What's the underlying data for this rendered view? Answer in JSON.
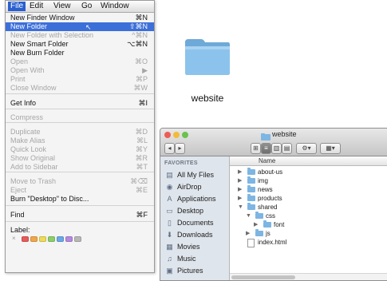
{
  "menubar": {
    "file": "File",
    "edit": "Edit",
    "view": "View",
    "go": "Go",
    "window": "Window"
  },
  "menu_items": [
    {
      "label": "New Finder Window",
      "shortcut": "⌘N",
      "state": "enabled"
    },
    {
      "label": "New Folder",
      "shortcut": "⇧⌘N",
      "state": "highlighted"
    },
    {
      "label": "New Folder with Selection",
      "shortcut": "^⌘N",
      "state": "disabled"
    },
    {
      "label": "New Smart Folder",
      "shortcut": "⌥⌘N",
      "state": "enabled"
    },
    {
      "label": "New Burn Folder",
      "shortcut": "",
      "state": "enabled"
    },
    {
      "label": "Open",
      "shortcut": "⌘O",
      "state": "disabled"
    },
    {
      "label": "Open With",
      "shortcut": "▶",
      "state": "disabled"
    },
    {
      "label": "Print",
      "shortcut": "⌘P",
      "state": "disabled"
    },
    {
      "label": "Close Window",
      "shortcut": "⌘W",
      "state": "disabled"
    },
    {
      "label": "Get Info",
      "shortcut": "⌘I",
      "state": "enabled"
    },
    {
      "label": "Compress",
      "shortcut": "",
      "state": "disabled"
    },
    {
      "label": "Duplicate",
      "shortcut": "⌘D",
      "state": "disabled"
    },
    {
      "label": "Make Alias",
      "shortcut": "⌘L",
      "state": "disabled"
    },
    {
      "label": "Quick Look",
      "shortcut": "⌘Y",
      "state": "disabled"
    },
    {
      "label": "Show Original",
      "shortcut": "⌘R",
      "state": "disabled"
    },
    {
      "label": "Add to Sidebar",
      "shortcut": "⌘T",
      "state": "disabled"
    },
    {
      "label": "Move to Trash",
      "shortcut": "⌘⌫",
      "state": "disabled"
    },
    {
      "label": "Eject",
      "shortcut": "⌘E",
      "state": "disabled"
    },
    {
      "label": "Burn \"Desktop\" to Disc...",
      "shortcut": "",
      "state": "enabled"
    },
    {
      "label": "Find",
      "shortcut": "⌘F",
      "state": "enabled"
    },
    {
      "label": "Label:",
      "shortcut": "",
      "state": "enabled"
    }
  ],
  "label_colors": [
    "#e85a5a",
    "#f0a74a",
    "#eedb58",
    "#8ccf6a",
    "#6aa8e8",
    "#b58ae0",
    "#b8b8b8"
  ],
  "folder": {
    "name": "website",
    "color": "#86bde8"
  },
  "finder": {
    "title": "website",
    "sidebar_heading": "FAVORITES",
    "sidebar_items": [
      {
        "label": "All My Files",
        "icon": "all-files-icon"
      },
      {
        "label": "AirDrop",
        "icon": "airdrop-icon"
      },
      {
        "label": "Applications",
        "icon": "applications-icon"
      },
      {
        "label": "Desktop",
        "icon": "desktop-icon"
      },
      {
        "label": "Documents",
        "icon": "documents-icon"
      },
      {
        "label": "Downloads",
        "icon": "downloads-icon"
      },
      {
        "label": "Movies",
        "icon": "movies-icon"
      },
      {
        "label": "Music",
        "icon": "music-icon"
      },
      {
        "label": "Pictures",
        "icon": "pictures-icon"
      }
    ],
    "column_name": "Name",
    "files": [
      {
        "name": "about-us",
        "depth": 0,
        "type": "folder",
        "expanded": false
      },
      {
        "name": "img",
        "depth": 0,
        "type": "folder",
        "expanded": false
      },
      {
        "name": "news",
        "depth": 0,
        "type": "folder",
        "expanded": false
      },
      {
        "name": "products",
        "depth": 0,
        "type": "folder",
        "expanded": false
      },
      {
        "name": "shared",
        "depth": 0,
        "type": "folder",
        "expanded": true
      },
      {
        "name": "css",
        "depth": 1,
        "type": "folder",
        "expanded": true
      },
      {
        "name": "font",
        "depth": 2,
        "type": "folder",
        "expanded": false
      },
      {
        "name": "js",
        "depth": 1,
        "type": "folder",
        "expanded": false
      },
      {
        "name": "index.html",
        "depth": 0,
        "type": "file",
        "expanded": false
      }
    ]
  }
}
